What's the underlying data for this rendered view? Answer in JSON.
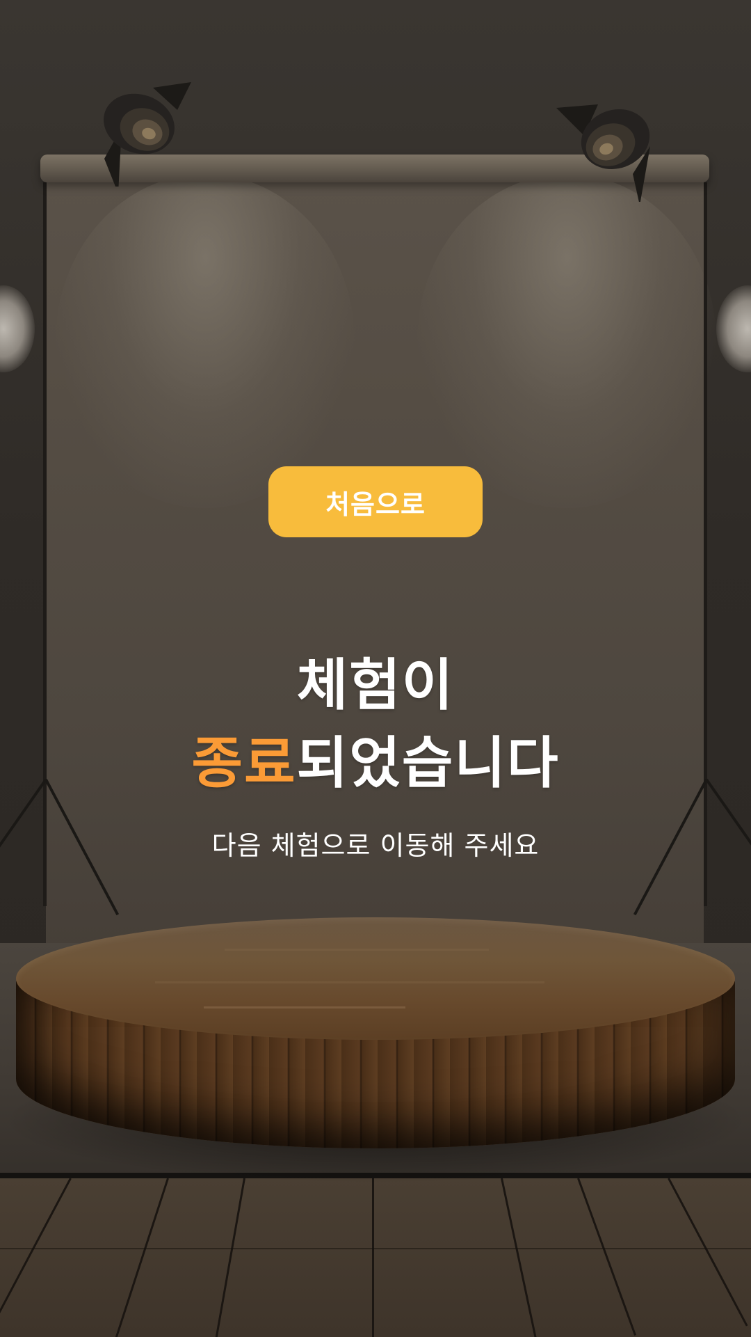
{
  "buttons": {
    "restart_label": "처음으로"
  },
  "message": {
    "title_line1": "체험이",
    "title_line2_accent": "종료",
    "title_line2_rest": "되었습니다",
    "subtitle": "다음 체험으로 이동해 주세요"
  },
  "colors": {
    "button_background": "#f8bc3c",
    "accent_text": "#fb9b36",
    "primary_text": "#ffffff"
  },
  "background": {
    "scene": "photo-studio-backdrop-with-wooden-podium",
    "icons": [
      "spotlight-icon",
      "spotlight-icon"
    ]
  }
}
